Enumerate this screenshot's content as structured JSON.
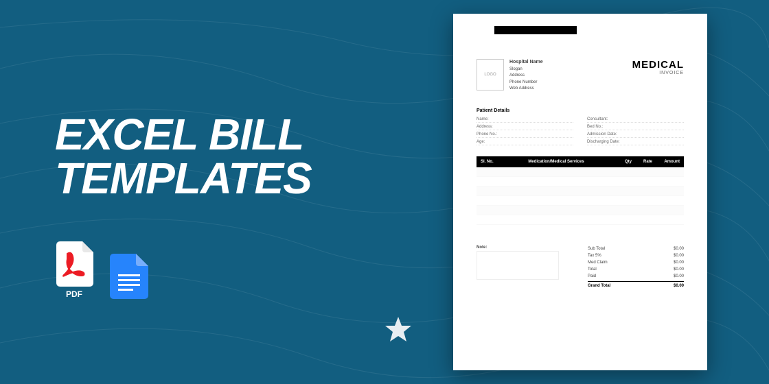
{
  "headline": {
    "line1": "EXCEL BILL",
    "line2": "TEMPLATES"
  },
  "icons": {
    "pdf_label": "PDF"
  },
  "invoice": {
    "logo_text": "LOGO",
    "hospital": {
      "name": "Hospital Name",
      "slogan": "Slogan",
      "address": "Address",
      "phone": "Phone Number",
      "web": "Web Address"
    },
    "title": {
      "main": "MEDICAL",
      "sub": "INVOICE"
    },
    "patient_title": "Patient Details",
    "patient_fields": {
      "name": "Name:",
      "consultant": "Consultant:",
      "address": "Address:",
      "bed": "Bed No.:",
      "phone": "Phone No.:",
      "admission": "Admission Date:",
      "age": "Age:",
      "discharge": "Discharging Date:"
    },
    "table_headers": {
      "sl": "Sl. No.",
      "med": "Medication/Medical Services",
      "qty": "Qty",
      "rate": "Rate",
      "amount": "Amount"
    },
    "note_label": "Note:",
    "totals": [
      {
        "label": "Sub Total",
        "value": "$0.00"
      },
      {
        "label": "Tax 5%",
        "value": "$0.00"
      },
      {
        "label": "Med Claim",
        "value": "$0.00"
      },
      {
        "label": "Total",
        "value": "$0.00"
      },
      {
        "label": "Paid",
        "value": "$0.00"
      }
    ],
    "grand_total": {
      "label": "Grand Total",
      "value": "$0.00"
    }
  }
}
